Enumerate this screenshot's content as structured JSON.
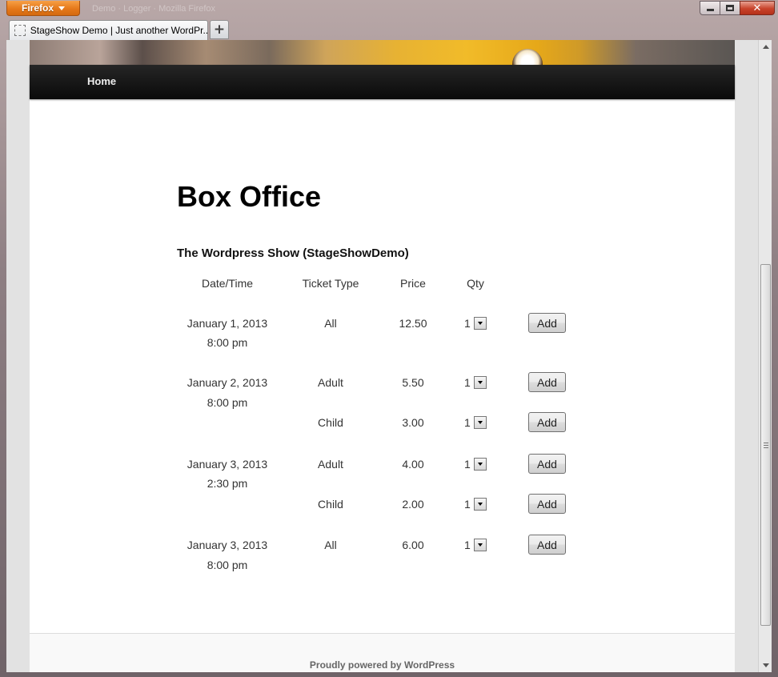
{
  "browser": {
    "app_button_label": "Firefox",
    "faint_title": "Demo · Logger · Mozilla Firefox",
    "tab_title": "StageShow Demo | Just another WordPr...",
    "new_tab_label": "+"
  },
  "site": {
    "nav": {
      "home_label": "Home"
    },
    "page_title": "Box Office",
    "show_title": "The Wordpress Show (StageShowDemo)",
    "columns": {
      "date": "Date/Time",
      "type": "Ticket Type",
      "price": "Price",
      "qty": "Qty"
    },
    "add_label": "Add",
    "rows": [
      {
        "date": "January 1, 2013",
        "time": "8:00 pm",
        "type": "All",
        "price": "12.50",
        "qty": "1"
      },
      {
        "date": "January 2, 2013",
        "time": "8:00 pm",
        "type": "Adult",
        "price": "5.50",
        "qty": "1"
      },
      {
        "date": "",
        "time": "",
        "type": "Child",
        "price": "3.00",
        "qty": "1"
      },
      {
        "date": "January 3, 2013",
        "time": "2:30 pm",
        "type": "Adult",
        "price": "4.00",
        "qty": "1"
      },
      {
        "date": "",
        "time": "",
        "type": "Child",
        "price": "2.00",
        "qty": "1"
      },
      {
        "date": "January 3, 2013",
        "time": "8:00 pm",
        "type": "All",
        "price": "6.00",
        "qty": "1"
      }
    ],
    "footer": "Proudly powered by WordPress"
  }
}
